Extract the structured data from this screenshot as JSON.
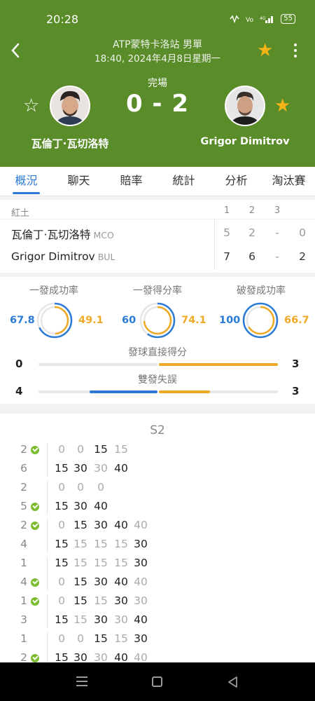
{
  "status_bar": {
    "time": "20:28",
    "battery": "55"
  },
  "header": {
    "tournament": "ATP蒙特卡洛站 男單",
    "datetime": "18:40, 2024年4月8日星期一",
    "status": "完場",
    "score": "0 - 2",
    "player1": "瓦倫丁·瓦切洛特",
    "player2": "Grigor Dimitrov"
  },
  "tabs": [
    "概況",
    "聊天",
    "賠率",
    "統計",
    "分析",
    "淘汰賽"
  ],
  "set_table": {
    "surface": "紅土",
    "set_headers": [
      "1",
      "2",
      "3"
    ],
    "rows": [
      {
        "name": "瓦倫丁·瓦切洛特",
        "country": "MCO",
        "sets": [
          "5",
          "2",
          "-"
        ],
        "total": "0"
      },
      {
        "name": "Grigor Dimitrov",
        "country": "BUL",
        "sets": [
          "7",
          "6",
          "-"
        ],
        "total": "2"
      }
    ]
  },
  "stats": {
    "circles": [
      {
        "label": "一發成功率",
        "p1": "67.8",
        "p2": "49.1",
        "p1_frac": 0.678,
        "p2_frac": 0.491
      },
      {
        "label": "一發得分率",
        "p1": "60",
        "p2": "74.1",
        "p1_frac": 0.6,
        "p2_frac": 0.741
      },
      {
        "label": "破發成功率",
        "p1": "100",
        "p2": "66.7",
        "p1_frac": 1.0,
        "p2_frac": 0.667
      }
    ],
    "bars": [
      {
        "label": "發球直接得分",
        "p1": "0",
        "p2": "3",
        "p1_frac": 0.0,
        "p2_frac": 1.0
      },
      {
        "label": "雙發失誤",
        "p1": "4",
        "p2": "3",
        "p1_frac": 0.57,
        "p2_frac": 0.43
      }
    ]
  },
  "point_by_point": {
    "set_title": "S2",
    "games": [
      {
        "p1_games": "2",
        "p2_games": "6",
        "server": 1,
        "p1_points": [
          "0",
          "0",
          "15",
          "15"
        ],
        "p2_points": [
          "15",
          "30",
          "30",
          "40"
        ],
        "p1_style": [
          1,
          1,
          0,
          1
        ],
        "p2_style": [
          0,
          0,
          1,
          0
        ]
      },
      {
        "p1_games": "2",
        "p2_games": "5",
        "server": 2,
        "p1_points": [
          "0",
          "0",
          "0"
        ],
        "p2_points": [
          "15",
          "30",
          "40"
        ],
        "p1_style": [
          1,
          1,
          1
        ],
        "p2_style": [
          0,
          0,
          0
        ]
      },
      {
        "p1_games": "2",
        "p2_games": "4",
        "server": 1,
        "p1_points": [
          "0",
          "15",
          "30",
          "40",
          "40"
        ],
        "p2_points": [
          "15",
          "15",
          "15",
          "15",
          "30"
        ],
        "p1_style": [
          1,
          0,
          0,
          0,
          1
        ],
        "p2_style": [
          0,
          1,
          1,
          1,
          0
        ]
      },
      {
        "p1_games": "1",
        "p2_games": "4",
        "server": 2,
        "p1_points": [
          "15",
          "15",
          "15",
          "15",
          "30"
        ],
        "p2_points": [
          "0",
          "15",
          "30",
          "40",
          "40"
        ],
        "p1_style": [
          0,
          1,
          1,
          1,
          0
        ],
        "p2_style": [
          1,
          0,
          0,
          0,
          1
        ]
      },
      {
        "p1_games": "1",
        "p2_games": "3",
        "server": 1,
        "p1_points": [
          "0",
          "15",
          "15",
          "30",
          "30"
        ],
        "p2_points": [
          "15",
          "15",
          "30",
          "30",
          "40"
        ],
        "p1_style": [
          1,
          0,
          1,
          0,
          1
        ],
        "p2_style": [
          0,
          1,
          0,
          1,
          0
        ]
      },
      {
        "p1_games": "1",
        "p2_games": "2",
        "server": 2,
        "p1_points": [
          "0",
          "0",
          "15",
          "15",
          "30"
        ],
        "p2_points": [
          "15",
          "30",
          "30",
          "40",
          "40"
        ],
        "p1_style": [
          1,
          1,
          0,
          1,
          0
        ],
        "p2_style": [
          0,
          0,
          1,
          0,
          1
        ]
      }
    ]
  },
  "colors": {
    "header": "#5a8c2a",
    "blue": "#2b7bd6",
    "orange": "#f0a924",
    "serve": "#7cbd2f"
  },
  "icons": [
    "back-icon",
    "star-icon",
    "more-icon",
    "serve-check-icon",
    "nav-menu-icon",
    "nav-home-icon",
    "nav-back-icon"
  ]
}
